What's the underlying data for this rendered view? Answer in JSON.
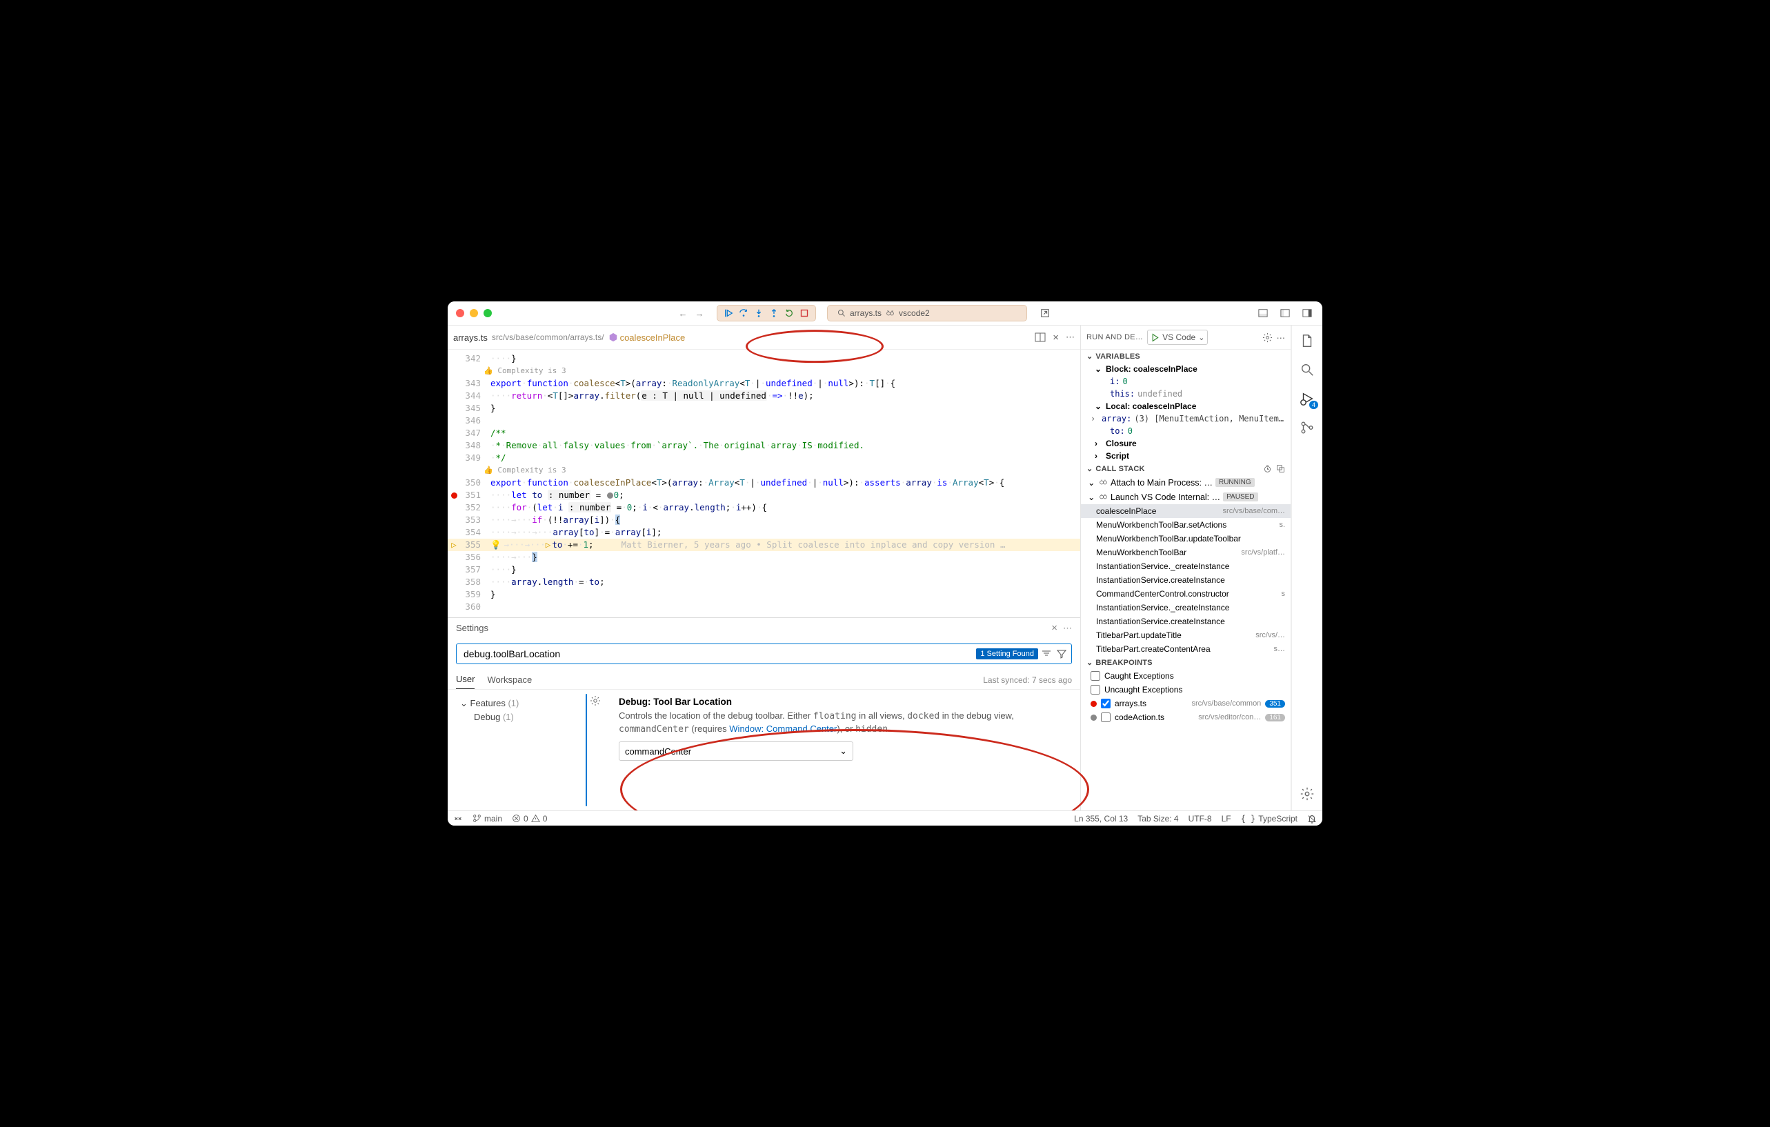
{
  "titlebar": {
    "search_prefix_icon": "search",
    "search_text": "arrays.ts",
    "search_workspace": "vscode2"
  },
  "tab": {
    "filename": "arrays.ts",
    "path": "src/vs/base/common/arrays.ts/",
    "symbol": "coalesceInPlace"
  },
  "editor": {
    "complexity_lens": "👍 Complexity is 3",
    "lines": {
      "342": "",
      "343": "export function coalesce<T>(array: ReadonlyArray<T | undefined | null>): T[] {",
      "344": "    return <T[]>array.filter(e : T | null | undefined => !!e);",
      "345": "}",
      "346": "",
      "347": "/**",
      "348": " * Remove all falsy values from `array`. The original array IS modified.",
      "349": " */",
      "350": "export function coalesceInPlace<T>(array: Array<T | undefined | null>): asserts array is Array<T> {",
      "351": "    let to : number = 0;",
      "352": "    for (let i : number = 0; i < array.length; i++) {",
      "353": "        if (!!array[i]) {",
      "354": "            array[to] = array[i];",
      "355": "            to += 1;",
      "356": "        }",
      "357": "    }",
      "358": "    array.length = to;",
      "359": "}",
      "360": ""
    },
    "blame": "Matt Bierner, 5 years ago • Split coalesce into inplace and copy version …"
  },
  "settings": {
    "title": "Settings",
    "search_value": "debug.toolBarLocation",
    "found_badge": "1 Setting Found",
    "tabs": {
      "user": "User",
      "workspace": "Workspace"
    },
    "last_synced": "Last synced: 7 secs ago",
    "tree": {
      "features": "Features",
      "features_count": "(1)",
      "debug": "Debug",
      "debug_count": "(1)"
    },
    "setting": {
      "title": "Debug: Tool Bar Location",
      "desc_pre": "Controls the location of the debug toolbar. Either ",
      "desc_float": "floating",
      "desc_mid1": " in all views, ",
      "desc_docked": "docked",
      "desc_mid2": " in the debug view, ",
      "desc_cc": "commandCenter",
      "desc_mid3": " (requires ",
      "desc_link": "Window: Command Center",
      "desc_mid4": "), or ",
      "desc_hidden": "hidden",
      "desc_end": ".",
      "value": "commandCenter"
    }
  },
  "debug": {
    "header": "RUN AND DE…",
    "config": "VS Code",
    "sections": {
      "variables": "VARIABLES",
      "callstack": "CALL STACK",
      "breakpoints": "BREAKPOINTS"
    },
    "scopes": {
      "block": "Block: coalesceInPlace",
      "local": "Local: coalesceInPlace",
      "closure": "Closure",
      "script": "Script"
    },
    "vars": {
      "i_name": "i:",
      "i_val": "0",
      "this_name": "this:",
      "this_val": "undefined",
      "array_name": "array:",
      "array_val": "(3) [MenuItemAction, MenuItem…",
      "to_name": "to:",
      "to_val": "0"
    },
    "callstack": [
      {
        "name": "Attach to Main Process: …",
        "status": "RUNNING",
        "kind": "session"
      },
      {
        "name": "Launch VS Code Internal: …",
        "status": "PAUSED",
        "kind": "session"
      },
      {
        "name": "coalesceInPlace",
        "path": "src/vs/base/com…",
        "sel": true
      },
      {
        "name": "MenuWorkbenchToolBar.setActions",
        "path": "s."
      },
      {
        "name": "MenuWorkbenchToolBar.updateToolbar",
        "path": ""
      },
      {
        "name": "MenuWorkbenchToolBar",
        "path": "src/vs/platf…"
      },
      {
        "name": "InstantiationService._createInstance",
        "path": ""
      },
      {
        "name": "InstantiationService.createInstance",
        "path": ""
      },
      {
        "name": "CommandCenterControl.constructor",
        "path": "s"
      },
      {
        "name": "InstantiationService._createInstance",
        "path": ""
      },
      {
        "name": "InstantiationService.createInstance",
        "path": ""
      },
      {
        "name": "TitlebarPart.updateTitle",
        "path": "src/vs/…"
      },
      {
        "name": "TitlebarPart.createContentArea",
        "path": "s…"
      }
    ],
    "breakpoints": {
      "caught": "Caught Exceptions",
      "uncaught": "Uncaught Exceptions",
      "bp1_name": "arrays.ts",
      "bp1_path": "src/vs/base/common",
      "bp1_line": "351",
      "bp2_name": "codeAction.ts",
      "bp2_path": "src/vs/editor/con…",
      "bp2_line": "161"
    }
  },
  "activity_badge": "4",
  "status": {
    "remote": "",
    "branch": "main",
    "errors": "0",
    "warnings": "0",
    "lncol": "Ln 355, Col 13",
    "tab": "Tab Size: 4",
    "encoding": "UTF-8",
    "eol": "LF",
    "lang": "TypeScript"
  }
}
